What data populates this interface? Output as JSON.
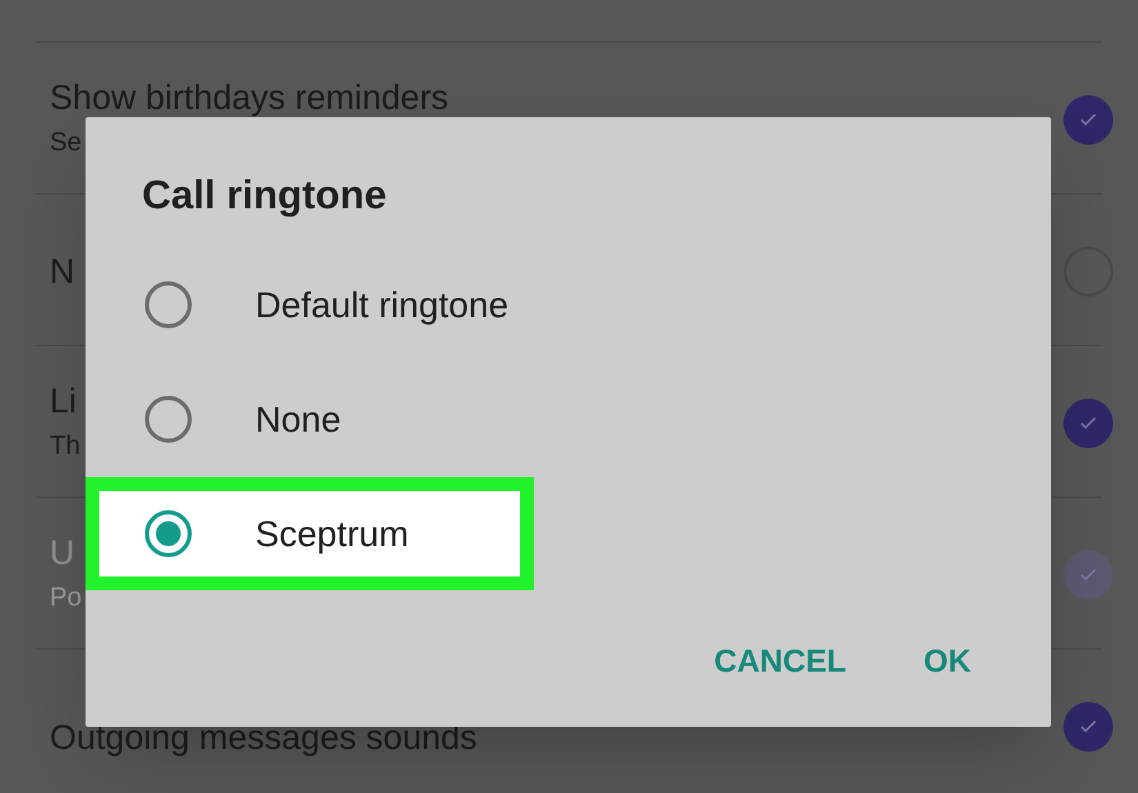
{
  "settings_rows": [
    {
      "title": "Show birthdays reminders",
      "subtitle": "Se",
      "checked": true,
      "disabled": false
    },
    {
      "title": "N",
      "checked": false,
      "disabled": false
    },
    {
      "title": "Li",
      "subtitle": "Th",
      "checked": true,
      "disabled": false
    },
    {
      "title": "U",
      "subtitle": "Po",
      "checked": true,
      "disabled": true
    },
    {
      "title": "Outgoing messages sounds",
      "checked": true,
      "disabled": false
    }
  ],
  "dialog": {
    "title": "Call ringtone",
    "options": [
      {
        "label": "Default ringtone",
        "selected": false,
        "highlighted": false
      },
      {
        "label": "None",
        "selected": false,
        "highlighted": false
      },
      {
        "label": "Sceptrum",
        "selected": true,
        "highlighted": true
      }
    ],
    "buttons": [
      "CANCEL",
      "OK"
    ]
  }
}
